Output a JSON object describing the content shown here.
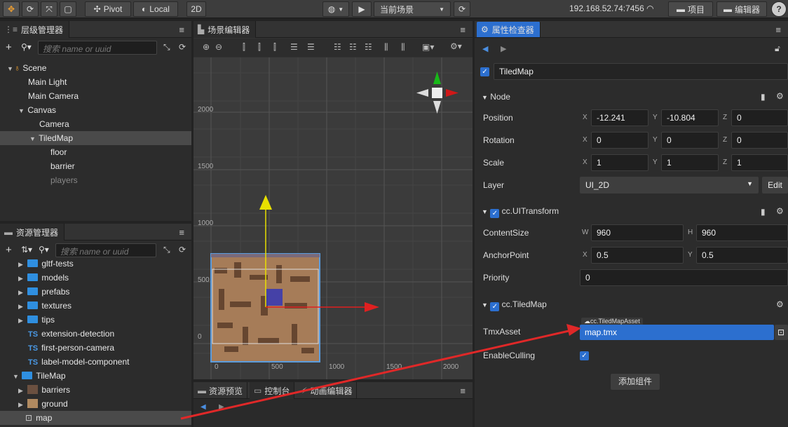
{
  "topbar": {
    "pivot_label": "Pivot",
    "local_label": "Local",
    "mode_2d": "2D",
    "scene_select": "当前场景",
    "ip": "192.168.52.74:7456",
    "project_label": "项目",
    "editor_label": "编辑器",
    "help": "?"
  },
  "hierarchy": {
    "title": "层级管理器",
    "search_placeholder": "搜索 name or uuid",
    "items": [
      {
        "label": "Scene"
      },
      {
        "label": "Main Light"
      },
      {
        "label": "Main Camera"
      },
      {
        "label": "Canvas"
      },
      {
        "label": "Camera"
      },
      {
        "label": "TiledMap"
      },
      {
        "label": "floor"
      },
      {
        "label": "barrier"
      },
      {
        "label": "players"
      }
    ]
  },
  "assets": {
    "title": "资源管理器",
    "search_placeholder": "搜索 name or uuid",
    "items": [
      {
        "label": "gltf-tests"
      },
      {
        "label": "models"
      },
      {
        "label": "prefabs"
      },
      {
        "label": "textures"
      },
      {
        "label": "tips"
      },
      {
        "label": "extension-detection",
        "badge": "TS"
      },
      {
        "label": "first-person-camera",
        "badge": "TS"
      },
      {
        "label": "label-model-component",
        "badge": "TS"
      },
      {
        "label": "TileMap"
      },
      {
        "label": "barriers"
      },
      {
        "label": "ground"
      },
      {
        "label": "map"
      }
    ]
  },
  "scene_editor": {
    "title": "场景编辑器",
    "y_ticks": [
      "2000",
      "1500",
      "1000",
      "500",
      "0"
    ],
    "x_ticks": [
      "0",
      "500",
      "1000",
      "1500",
      "2000"
    ]
  },
  "bottom_tabs": [
    {
      "label": "资源预览"
    },
    {
      "label": "控制台"
    },
    {
      "label": "动画编辑器"
    }
  ],
  "inspector": {
    "title": "属性检查器",
    "node_name": "TiledMap",
    "node_section": "Node",
    "position": {
      "label": "Position",
      "x": "-12.241",
      "y": "-10.804",
      "z": "0"
    },
    "rotation": {
      "label": "Rotation",
      "x": "0",
      "y": "0",
      "z": "0"
    },
    "scale": {
      "label": "Scale",
      "x": "1",
      "y": "1",
      "z": "1"
    },
    "layer": {
      "label": "Layer",
      "value": "UI_2D",
      "edit": "Edit"
    },
    "uitransform": {
      "title": "cc.UITransform",
      "content_size_label": "ContentSize",
      "w": "960",
      "h": "960",
      "anchor_label": "AnchorPoint",
      "ax": "0.5",
      "ay": "0.5",
      "priority_label": "Priority",
      "priority": "0"
    },
    "tiledmap": {
      "title": "cc.TiledMap",
      "tmx_label": "TmxAsset",
      "tmx_badge": "cc.TiledMapAsset",
      "tmx_value": "map.tmx",
      "culling_label": "EnableCulling"
    },
    "add_component": "添加组件",
    "axis_letters": {
      "x": "X",
      "y": "Y",
      "z": "Z",
      "w": "W",
      "h": "H"
    }
  }
}
